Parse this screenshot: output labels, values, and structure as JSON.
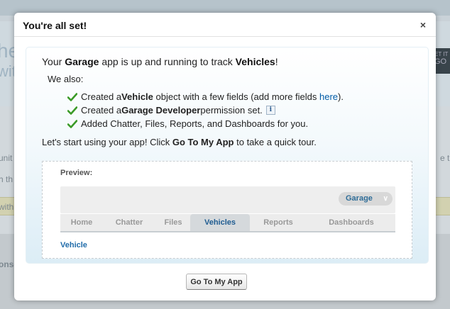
{
  "background": {
    "fragments": [
      "he",
      "with",
      "unit",
      "h th",
      "with",
      "onso",
      "e t",
      "ET IT",
      "GO"
    ]
  },
  "dialog": {
    "title": "You're all set!",
    "close_glyph": "×",
    "headline": {
      "part1": "Your ",
      "app_name": "Garage",
      "part2": " app is up and running to track ",
      "object_name": "Vehicles",
      "part3": "!"
    },
    "also_label": "We also:",
    "items": [
      {
        "pre": "Created a ",
        "bold": "Vehicle",
        "post": " object with a few fields (add more fields ",
        "link": "here",
        "tail": ")."
      },
      {
        "pre": "Created a ",
        "bold": "Garage Developer",
        "post": " permission set.",
        "info": "i"
      },
      {
        "pre": "Added Chatter, Files, Reports, and Dashboards for you."
      }
    ],
    "cta": {
      "pre": "Let's start using your app! Click ",
      "bold": "Go To My App",
      "post": " to take a quick tour."
    },
    "preview": {
      "label": "Preview:",
      "app_selector": "Garage",
      "tabs": [
        "Home",
        "Chatter",
        "Files",
        "Vehicles",
        "Reports",
        "Dashboards"
      ],
      "active_tab": "Vehicles",
      "sub_link": "Vehicle"
    },
    "go_button": "Go To My App"
  },
  "colors": {
    "check_green": "#3a9a27",
    "link_blue": "#015ba7",
    "active_tab_text": "#1f5c91"
  }
}
